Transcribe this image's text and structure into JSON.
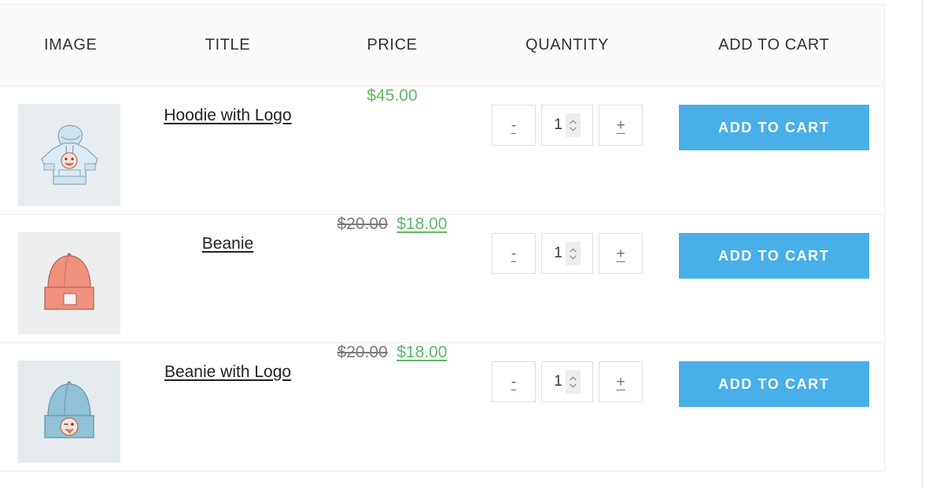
{
  "table": {
    "headers": [
      {
        "label": "IMAGE",
        "name": "column-header-image"
      },
      {
        "label": "TITLE",
        "name": "column-header-title"
      },
      {
        "label": "PRICE",
        "name": "column-header-price"
      },
      {
        "label": "QUANTITY",
        "name": "column-header-quantity"
      },
      {
        "label": "ADD TO CART",
        "name": "column-header-add-to-cart"
      }
    ],
    "rows": [
      {
        "image_alt": "hoodie-with-logo-thumbnail",
        "title": "Hoodie with Logo",
        "price_old": "",
        "price_current": "$45.00",
        "on_sale": false,
        "quantity": "1",
        "decrement_label": "-",
        "increment_label": "+",
        "add_to_cart_label": "ADD TO CART"
      },
      {
        "image_alt": "beanie-thumbnail",
        "title": "Beanie",
        "price_old": "$20.00",
        "price_current": "$18.00",
        "on_sale": true,
        "quantity": "1",
        "decrement_label": "-",
        "increment_label": "+",
        "add_to_cart_label": "ADD TO CART"
      },
      {
        "image_alt": "beanie-with-logo-thumbnail",
        "title": "Beanie with Logo",
        "price_old": "$20.00",
        "price_current": "$18.00",
        "on_sale": true,
        "quantity": "1",
        "decrement_label": "-",
        "increment_label": "+",
        "add_to_cart_label": "ADD TO CART"
      }
    ]
  },
  "colors": {
    "price_green": "#5db963",
    "price_old_gray": "#7b7b7b",
    "button_blue": "#49afe8",
    "header_background": "#fafafa",
    "thumb_background": "#e7ecef",
    "border": "#ebebeb"
  }
}
